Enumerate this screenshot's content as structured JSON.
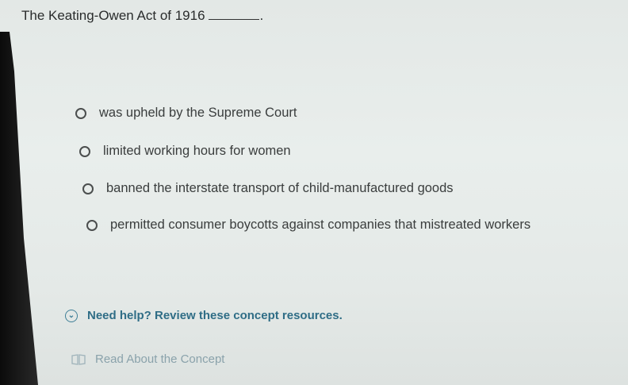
{
  "question": {
    "text": "The Keating-Owen Act of 1916",
    "period": "."
  },
  "options": [
    {
      "label": "was upheld by the Supreme Court"
    },
    {
      "label": "limited working hours for women"
    },
    {
      "label": "banned the interstate transport of child-manufactured goods"
    },
    {
      "label": "permitted consumer boycotts against companies that mistreated workers"
    }
  ],
  "help": {
    "label": "Need help? Review these concept resources.",
    "icon": "chevron-down-circle-icon",
    "color": "#2f6d86"
  },
  "resources": {
    "read_label": "Read About the Concept",
    "icon": "book-icon"
  }
}
